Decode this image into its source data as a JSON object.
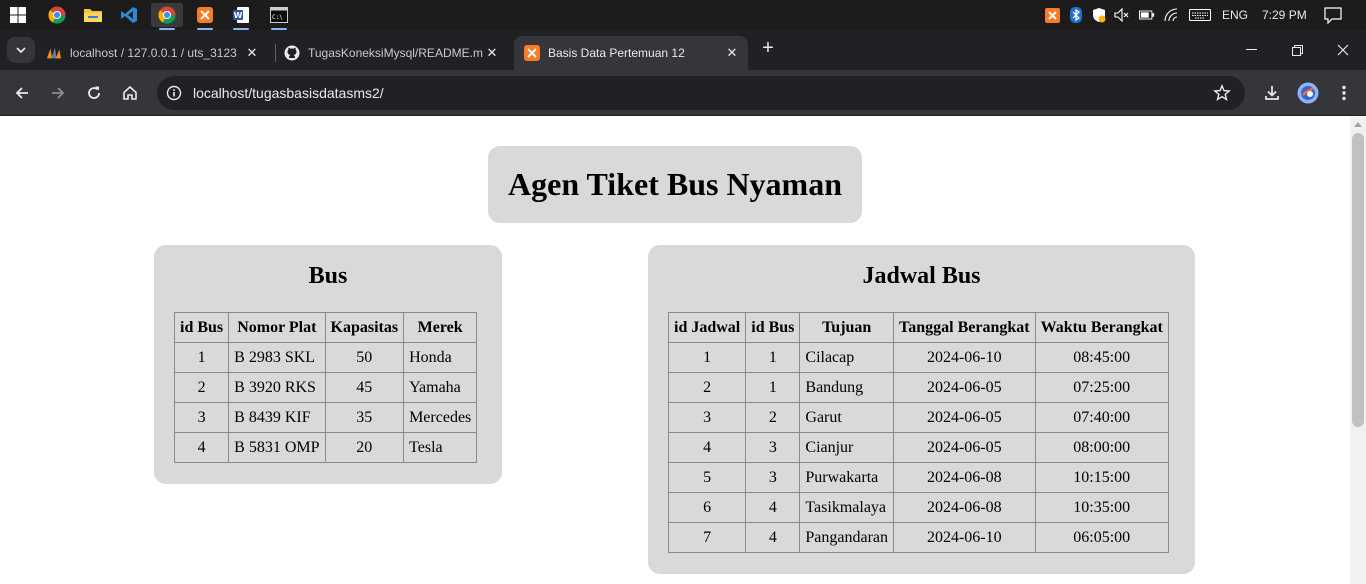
{
  "taskbar": {
    "apps": [
      "windows-start",
      "chrome",
      "file-explorer",
      "vs-code",
      "chrome",
      "xampp",
      "word",
      "command-prompt"
    ],
    "tray": {
      "language": "ENG",
      "time": "7:29 PM"
    }
  },
  "browser": {
    "tabs": [
      {
        "title": "localhost / 127.0.0.1 / uts_3123",
        "favicon": "phpmyadmin-icon"
      },
      {
        "title": "TugasKoneksiMysql/README.m",
        "favicon": "github-icon"
      },
      {
        "title": "Basis Data Pertemuan 12",
        "favicon": "xampp-icon",
        "active": true
      }
    ],
    "url": "localhost/tugasbasisdatasms2/"
  },
  "page": {
    "title": "Agen Tiket Bus Nyaman",
    "bus": {
      "heading": "Bus",
      "columns": [
        "id Bus",
        "Nomor Plat",
        "Kapasitas",
        "Merek"
      ],
      "rows": [
        [
          "1",
          "B 2983 SKL",
          "50",
          "Honda"
        ],
        [
          "2",
          "B 3920 RKS",
          "45",
          "Yamaha"
        ],
        [
          "3",
          "B 8439 KIF",
          "35",
          "Mercedes"
        ],
        [
          "4",
          "B 5831 OMP",
          "20",
          "Tesla"
        ]
      ]
    },
    "jadwal": {
      "heading": "Jadwal Bus",
      "columns": [
        "id Jadwal",
        "id Bus",
        "Tujuan",
        "Tanggal Berangkat",
        "Waktu Berangkat"
      ],
      "rows": [
        [
          "1",
          "1",
          "Cilacap",
          "2024-06-10",
          "08:45:00"
        ],
        [
          "2",
          "1",
          "Bandung",
          "2024-06-05",
          "07:25:00"
        ],
        [
          "3",
          "2",
          "Garut",
          "2024-06-05",
          "07:40:00"
        ],
        [
          "4",
          "3",
          "Cianjur",
          "2024-06-05",
          "08:00:00"
        ],
        [
          "5",
          "3",
          "Purwakarta",
          "2024-06-08",
          "10:15:00"
        ],
        [
          "6",
          "4",
          "Tasikmalaya",
          "2024-06-08",
          "10:35:00"
        ],
        [
          "7",
          "4",
          "Pangandaran",
          "2024-06-10",
          "06:05:00"
        ]
      ]
    }
  },
  "colors": {
    "card_bg": "#d9d9d9",
    "chrome_dark": "#202124",
    "chrome_toolbar": "#35363a"
  }
}
